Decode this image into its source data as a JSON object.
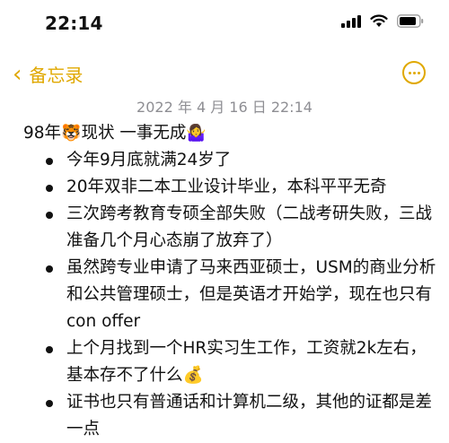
{
  "status_bar": {
    "time": "22:14"
  },
  "nav": {
    "back_label": "备忘录"
  },
  "note": {
    "date": "2022 年 4 月 16 日 22:14",
    "title_prefix": "98年",
    "title_emoji": "🐯",
    "title_suffix": "现状  一事无成",
    "title_end_emoji": "🤷‍♀️",
    "items": [
      {
        "text": "今年9月底就满24岁了"
      },
      {
        "text": "20年双非二本工业设计毕业，本科平平无奇"
      },
      {
        "text": "三次跨考教育专硕全部失败（二战考研失败，三战准备几个月心态崩了放弃了）"
      },
      {
        "text": "虽然跨专业申请了马来西亚硕士，USM的商业分析和公共管理硕士，但是英语才开始学，现在也只有con offer"
      },
      {
        "text": "上个月找到一个HR实习生工作，工资就2k左右，基本存不了什么💰"
      },
      {
        "text": "证书也只有普通话和计算机二级，其他的证都是差一点"
      }
    ]
  },
  "colors": {
    "accent": "#E0A800",
    "text": "#111111",
    "muted": "#8e8e93"
  },
  "icons": [
    "signal-icon",
    "wifi-icon",
    "battery-icon",
    "chevron-left-icon",
    "more-icon"
  ]
}
